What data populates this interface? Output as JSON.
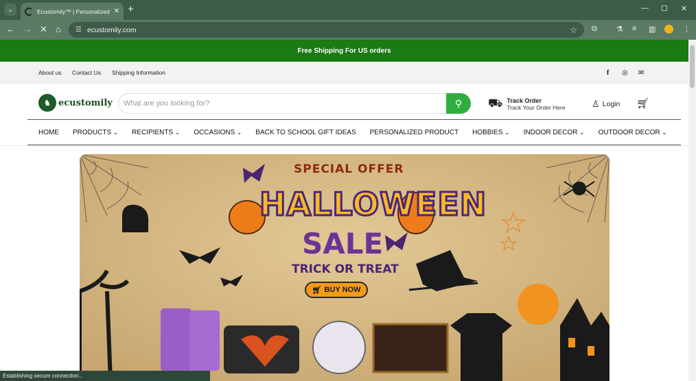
{
  "browser": {
    "tab_title": "Ecustomily™ | Personalized & C",
    "url": "ecustomily.com",
    "status": "Establishing secure connection..."
  },
  "announcement": "Free Shipping For US orders",
  "utility_links": [
    "About us",
    "Contact Us",
    "Shipping Information"
  ],
  "social_icons": [
    "facebook-icon",
    "instagram-icon",
    "mail-icon"
  ],
  "header": {
    "logo_text": "ecustomily",
    "search_placeholder": "What are you looking for?",
    "track_title": "Track Order",
    "track_subtitle": "Track Your Order Here",
    "login_label": "Login"
  },
  "menu": [
    {
      "label": "HOME",
      "has_dropdown": false
    },
    {
      "label": "PRODUCTS",
      "has_dropdown": true
    },
    {
      "label": "RECIPIENTS",
      "has_dropdown": true
    },
    {
      "label": "OCCASIONS",
      "has_dropdown": true
    },
    {
      "label": "BACK TO SCHOOL GIFT IDEAS",
      "has_dropdown": false
    },
    {
      "label": "PERSONALIZED PRODUCT",
      "has_dropdown": false
    },
    {
      "label": "HOBBIES",
      "has_dropdown": true
    },
    {
      "label": "INDOOR DECOR",
      "has_dropdown": true
    },
    {
      "label": "OUTDOOR DECOR",
      "has_dropdown": true
    }
  ],
  "banner": {
    "special_offer": "SPECIAL OFFER",
    "headline": "HALLOWEEN",
    "sale": "SALE",
    "tagline": "TRICK OR TREAT",
    "cta": "BUY NOW"
  },
  "colors": {
    "announcement_bg": "#1a7a13",
    "search_button": "#2fae3f",
    "browser_frame": "#3d5c48"
  }
}
